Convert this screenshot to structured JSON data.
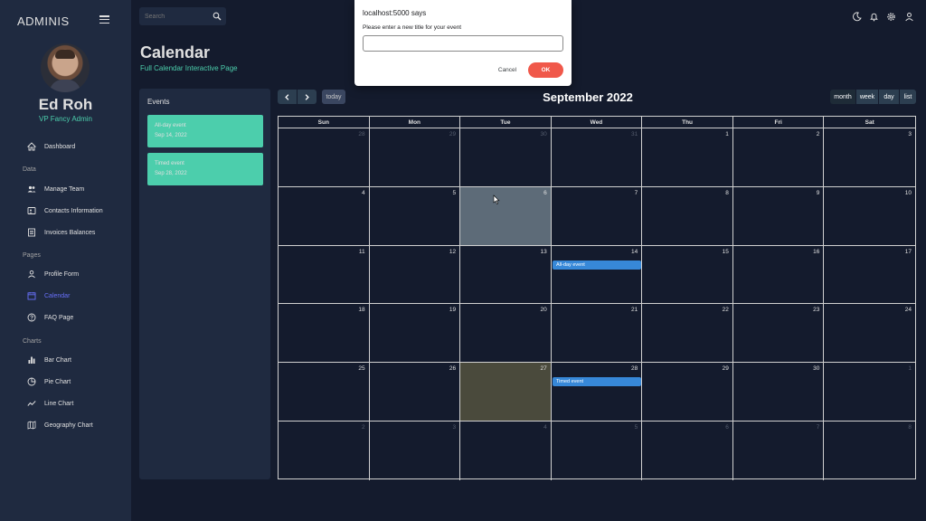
{
  "brand": "ADMINIS",
  "user": {
    "name": "Ed Roh",
    "role": "VP Fancy Admin"
  },
  "sidebar": {
    "items": [
      {
        "label": "Dashboard",
        "icon": "home-icon"
      },
      {
        "section": "Data"
      },
      {
        "label": "Manage Team",
        "icon": "team-icon"
      },
      {
        "label": "Contacts Information",
        "icon": "contacts-icon"
      },
      {
        "label": "Invoices Balances",
        "icon": "receipt-icon"
      },
      {
        "section": "Pages"
      },
      {
        "label": "Profile Form",
        "icon": "person-icon"
      },
      {
        "label": "Calendar",
        "icon": "calendar-icon",
        "active": true
      },
      {
        "label": "FAQ Page",
        "icon": "help-icon"
      },
      {
        "section": "Charts"
      },
      {
        "label": "Bar Chart",
        "icon": "bar-chart-icon"
      },
      {
        "label": "Pie Chart",
        "icon": "pie-chart-icon"
      },
      {
        "label": "Line Chart",
        "icon": "line-chart-icon"
      },
      {
        "label": "Geography Chart",
        "icon": "map-icon"
      }
    ]
  },
  "topbar": {
    "search_placeholder": "Search",
    "icons": [
      "dark-mode-icon",
      "notifications-icon",
      "settings-icon",
      "person-icon"
    ]
  },
  "page": {
    "title": "Calendar",
    "subtitle": "Full Calendar Interactive Page"
  },
  "events_panel": {
    "title": "Events",
    "events": [
      {
        "title": "All-day event",
        "date": "Sep 14, 2022"
      },
      {
        "title": "Timed event",
        "date": "Sep 28, 2022"
      }
    ]
  },
  "calendar": {
    "title": "September 2022",
    "today_label": "today",
    "views": [
      "month",
      "week",
      "day",
      "list"
    ],
    "active_view": "month",
    "weekdays": [
      "Sun",
      "Mon",
      "Tue",
      "Wed",
      "Thu",
      "Fri",
      "Sat"
    ],
    "weeks": [
      [
        28,
        29,
        30,
        31,
        1,
        2,
        3
      ],
      [
        4,
        5,
        6,
        7,
        8,
        9,
        10
      ],
      [
        11,
        12,
        13,
        14,
        15,
        16,
        17
      ],
      [
        18,
        19,
        20,
        21,
        22,
        23,
        24
      ],
      [
        25,
        26,
        27,
        28,
        29,
        30,
        1
      ],
      [
        2,
        3,
        4,
        5,
        6,
        7,
        8
      ]
    ],
    "selected_day": 6,
    "today_day": 27,
    "events": [
      {
        "title": "All-day event",
        "day": 14
      },
      {
        "title": "Timed event",
        "day": 28
      }
    ]
  },
  "dialog": {
    "title": "localhost:5000 says",
    "message": "Please enter a new title for your event",
    "input_value": "",
    "cancel_label": "Cancel",
    "ok_label": "OK"
  },
  "colors": {
    "background": "#141b2d",
    "panel": "#1f2a40",
    "accent_green": "#4cceac",
    "accent_blue": "#6870fa",
    "event_blue": "#3788d8",
    "ok_red": "#f0584a"
  }
}
